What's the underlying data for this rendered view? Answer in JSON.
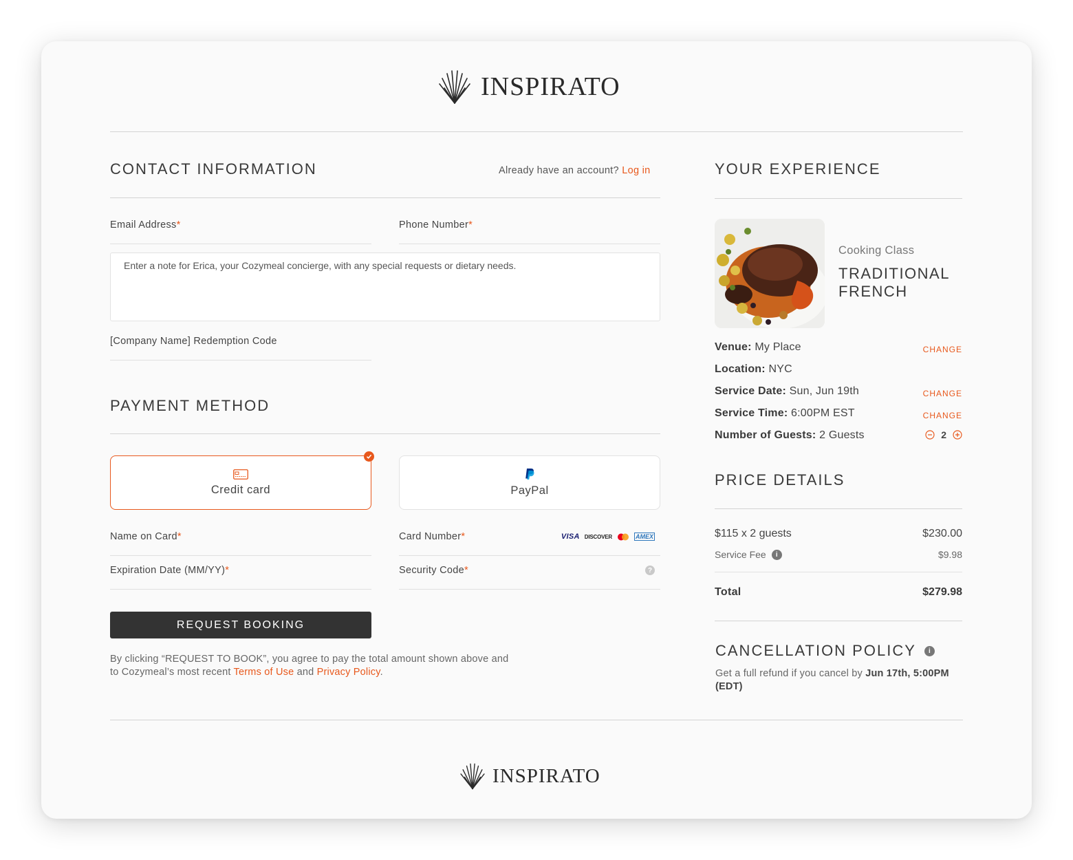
{
  "brand": {
    "name": "INSPIRATO",
    "icon": "palm-fan-icon"
  },
  "contact": {
    "title": "CONTACT INFORMATION",
    "account_prompt": "Already have an account?",
    "login_link": "Log in",
    "email_label": "Email Address",
    "phone_label": "Phone Number",
    "required_mark": "*",
    "note_placeholder": "Enter a note for Erica, your Cozymeal concierge, with any special requests or dietary needs.",
    "redemption_label": "[Company Name] Redemption Code"
  },
  "payment": {
    "title": "PAYMENT METHOD",
    "options": [
      {
        "label": "Credit card",
        "icon": "credit-card-icon",
        "selected": true
      },
      {
        "label": "PayPal",
        "icon": "paypal-icon",
        "selected": false
      }
    ],
    "name_label": "Name on Card",
    "card_number_label": "Card Number",
    "card_brands": [
      "VISA",
      "DISCOVER",
      "MASTERCARD",
      "AMEX"
    ],
    "expiration_label": "Expiration Date (MM/YY)",
    "security_label": "Security Code",
    "help_icon": "?",
    "submit_label": "REQUEST BOOKING",
    "terms_prefix": "By clicking “REQUEST TO BOOK”, you agree to pay the total amount shown above and to Cozymeal’s most recent",
    "terms_link": "Terms of Use",
    "terms_and": "and",
    "privacy_link": "Privacy Policy",
    "terms_suffix": "."
  },
  "experience": {
    "title": "YOUR EXPERIENCE",
    "category": "Cooking Class",
    "name_line1": "TRADITIONAL",
    "name_line2": "FRENCH",
    "details": [
      {
        "key": "Venue:",
        "value": "My Place",
        "action": "CHANGE"
      },
      {
        "key": "Location:",
        "value": "NYC",
        "action": ""
      },
      {
        "key": "Service Date:",
        "value": "Sun, Jun 19th",
        "action": "CHANGE"
      },
      {
        "key": "Service Time:",
        "value": "6:00PM EST",
        "action": "CHANGE"
      },
      {
        "key": "Number of Guests:",
        "value": "2 Guests",
        "action": ""
      }
    ],
    "guest_count": "2"
  },
  "price": {
    "title": "PRICE DETAILS",
    "line_label": "$115 x 2 guests",
    "line_value": "$230.00",
    "fee_label": "Service Fee",
    "fee_value": "$9.98",
    "total_label": "Total",
    "total_value": "$279.98"
  },
  "cancellation": {
    "title": "CANCELLATION POLICY",
    "text_prefix": "Get a full refund if you cancel by",
    "deadline": "Jun 17th, 5:00PM (EDT)"
  },
  "colors": {
    "accent": "#e8581c",
    "button": "#333333",
    "card_bg": "#fafafa"
  }
}
